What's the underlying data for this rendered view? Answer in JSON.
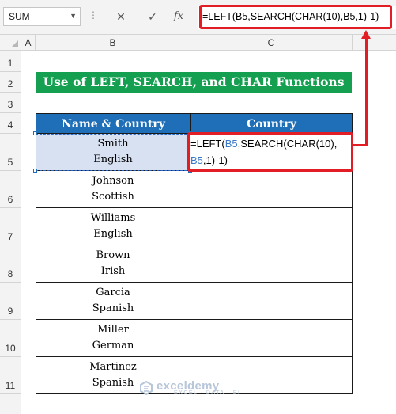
{
  "formula_bar": {
    "name_box": "SUM",
    "cancel_icon": "close-icon",
    "enter_icon": "check-icon",
    "fx_label": "fx",
    "formula": "=LEFT(B5,SEARCH(CHAR(10),B5,1)-1)"
  },
  "columns": [
    "A",
    "B",
    "C"
  ],
  "rows": [
    "1",
    "2",
    "3",
    "4",
    "5",
    "6",
    "7",
    "8",
    "9",
    "10",
    "11"
  ],
  "title": "Use of LEFT, SEARCH, and CHAR Functions",
  "table": {
    "headers": [
      "Name & Country",
      "Country"
    ],
    "rows": [
      [
        "Smith",
        "English"
      ],
      [
        "Johnson",
        "Scottish"
      ],
      [
        "Williams",
        "English"
      ],
      [
        "Brown",
        "Irish"
      ],
      [
        "Garcia",
        "Spanish"
      ],
      [
        "Miller",
        "German"
      ],
      [
        "Martinez",
        "Spanish"
      ]
    ]
  },
  "cell_formula": {
    "p1": "=LEFT(",
    "p2": "B5",
    "p3": ",SEARCH(CHAR(10),",
    "p4": "B5",
    "p5": ",1)-1)"
  },
  "watermark": {
    "name": "exceldemy",
    "tagline": "EXCEL · DATA · BI"
  },
  "colors": {
    "title_bg": "#14a050",
    "header_bg": "#1f6fb8",
    "highlight": "#e21d25",
    "selected_cell": "#d8e1f2"
  }
}
